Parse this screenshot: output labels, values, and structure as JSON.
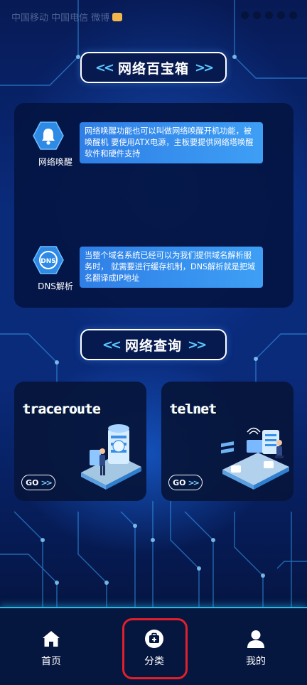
{
  "status_bar": {
    "left_text": "中国移动 中国电信 微博"
  },
  "section_tools": {
    "title": "网络百宝箱",
    "chev_left": "<<",
    "chev_right": ">>"
  },
  "tools": [
    {
      "label": "网络唤醒",
      "icon": "bell-icon",
      "description": "网络唤醒功能也可以叫做网络唤醒开机功能，被唤醒机 要使用ATX电源，主板要提供网络塔唤醒软件和硬件支持"
    },
    {
      "label": "DNS解析",
      "icon": "dns-icon",
      "icon_text": "DNS",
      "description": "当整个域名系统已经可以为我们提供域名解析服务时， 就需要进行缓存机制，DNS解析就是把域名翻译成IP地址"
    }
  ],
  "section_query": {
    "title": "网络查询",
    "chev_left": "<<",
    "chev_right": ">>"
  },
  "query_cards": [
    {
      "title": "traceroute",
      "go_label": "GO",
      "go_chev": ">>"
    },
    {
      "title": "telnet",
      "go_label": "GO",
      "go_chev": ">>"
    }
  ],
  "bottom_nav": {
    "items": [
      {
        "label": "首页",
        "icon": "home-icon"
      },
      {
        "label": "分类",
        "icon": "category-icon"
      },
      {
        "label": "我的",
        "icon": "profile-icon"
      }
    ],
    "active_index": 1
  },
  "colors": {
    "background": "#05123d",
    "accent": "#2fb6e6",
    "description_bg": "#3e9ff5",
    "highlight": "#e0202a"
  }
}
